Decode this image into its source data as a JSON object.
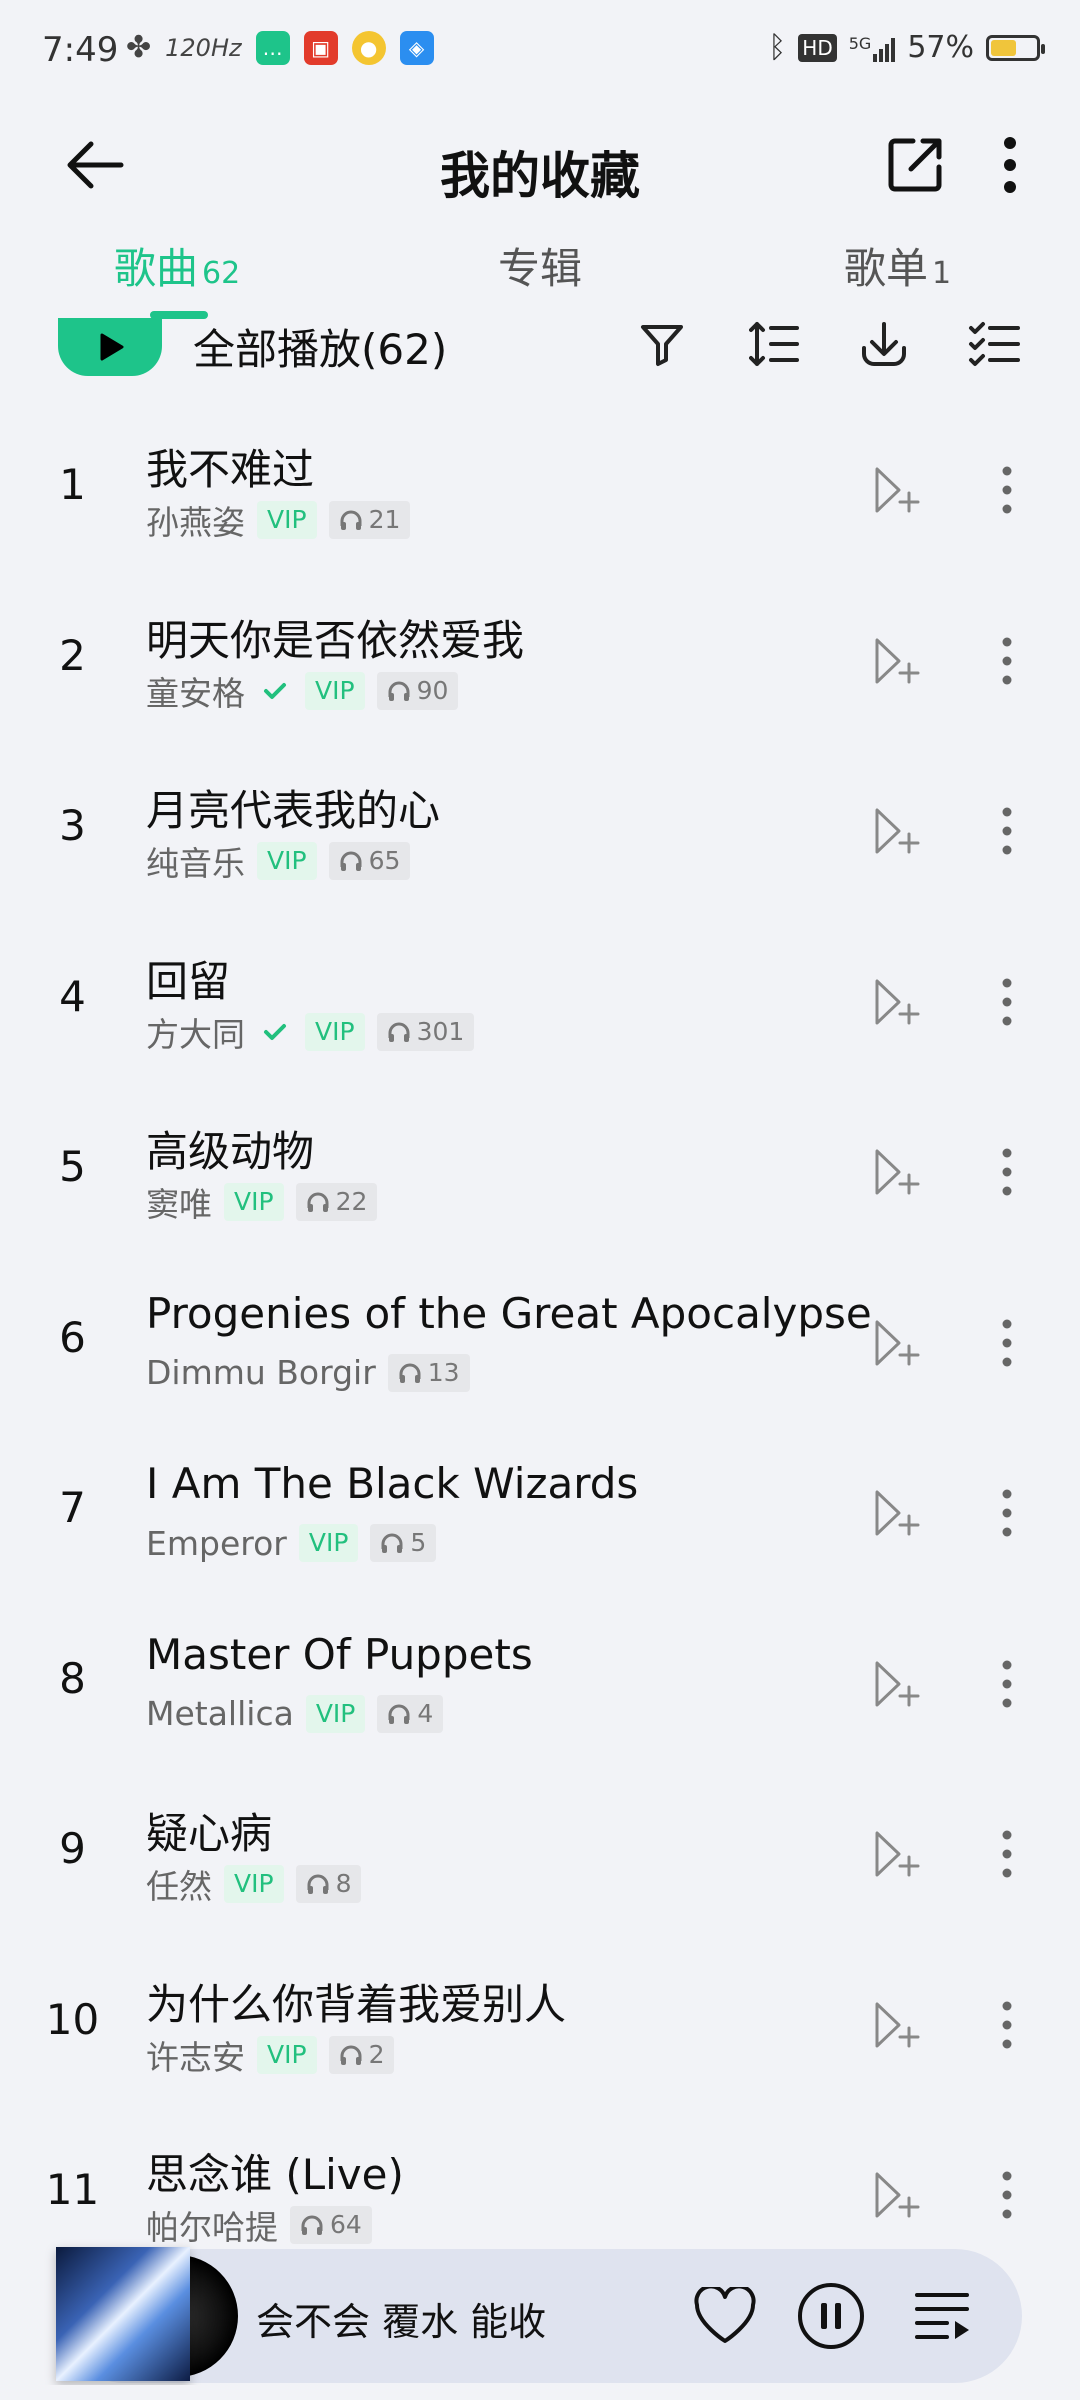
{
  "status_bar": {
    "time": "7:49",
    "network": "5G",
    "battery_percent": "57%",
    "battery_level": 0.57,
    "hd_label": "HD",
    "refresh_label": "120Hz"
  },
  "header": {
    "title": "我的收藏"
  },
  "tabs": [
    {
      "label": "歌曲",
      "count": "62",
      "active": true
    },
    {
      "label": "专辑",
      "count": "",
      "active": false
    },
    {
      "label": "歌单",
      "count": "1",
      "active": false
    }
  ],
  "actions": {
    "play_all_label": "全部播放(62)"
  },
  "songs": [
    {
      "index": "1",
      "title": "我不难过",
      "artist": "孙燕姿",
      "verified": false,
      "vip": "VIP",
      "listens": "21"
    },
    {
      "index": "2",
      "title": "明天你是否依然爱我",
      "artist": "童安格",
      "verified": true,
      "vip": "VIP",
      "listens": "90"
    },
    {
      "index": "3",
      "title": "月亮代表我的心",
      "artist": "纯音乐",
      "verified": false,
      "vip": "VIP",
      "listens": "65"
    },
    {
      "index": "4",
      "title": "回留",
      "artist": "方大同",
      "verified": true,
      "vip": "VIP",
      "listens": "301"
    },
    {
      "index": "5",
      "title": "高级动物",
      "artist": "窦唯",
      "verified": false,
      "vip": "VIP",
      "listens": "22"
    },
    {
      "index": "6",
      "title": "Progenies of the Great Apocalypse",
      "artist": "Dimmu Borgir",
      "verified": false,
      "vip": "",
      "listens": "13"
    },
    {
      "index": "7",
      "title": "I Am The Black Wizards",
      "artist": "Emperor",
      "verified": false,
      "vip": "VIP",
      "listens": "5"
    },
    {
      "index": "8",
      "title": "Master Of Puppets",
      "artist": "Metallica",
      "verified": false,
      "vip": "VIP",
      "listens": "4"
    },
    {
      "index": "9",
      "title": "疑心病",
      "artist": "任然",
      "verified": false,
      "vip": "VIP",
      "listens": "8"
    },
    {
      "index": "10",
      "title": "为什么你背着我爱别人",
      "artist": "许志安",
      "verified": false,
      "vip": "VIP",
      "listens": "2"
    },
    {
      "index": "11",
      "title": "思念谁 (Live)",
      "artist": "帕尔哈提",
      "verified": false,
      "vip": "",
      "listens": "64"
    }
  ],
  "player": {
    "now_playing": "会不会 覆水 能收"
  },
  "colors": {
    "accent": "#1ec48a",
    "background": "#f2f3f7"
  }
}
